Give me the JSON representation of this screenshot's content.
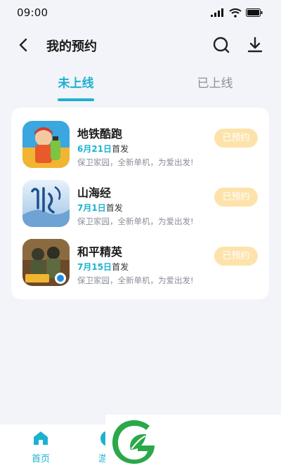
{
  "status_bar": {
    "time": "09:00"
  },
  "header": {
    "title": "我的预约"
  },
  "tabs": [
    {
      "label": "未上线",
      "active": true
    },
    {
      "label": "已上线",
      "active": false
    }
  ],
  "games": [
    {
      "name": "地铁酷跑",
      "date": "6月21日",
      "release_suffix": "首发",
      "description": "保卫家园，全新单机，为爱出发!",
      "button_label": "已预约",
      "icon": "subway-surfers-icon"
    },
    {
      "name": "山海经",
      "date": "7月1日",
      "release_suffix": "首发",
      "description": "保卫家园，全新单机，为爱出发!",
      "button_label": "已预约",
      "icon": "shanhaijing-icon"
    },
    {
      "name": "和平精英",
      "date": "7月15日",
      "release_suffix": "首发",
      "description": "保卫家园，全新单机，为爱出发!",
      "button_label": "已预约",
      "icon": "peace-elite-icon"
    }
  ],
  "bottom_nav": [
    {
      "label": "首页"
    },
    {
      "label": "游"
    }
  ],
  "colors": {
    "accent": "#1bb1d1",
    "reserved_button": "#fde3ab",
    "background": "#f2f4f9",
    "watermark_green": "#2aa84a"
  }
}
